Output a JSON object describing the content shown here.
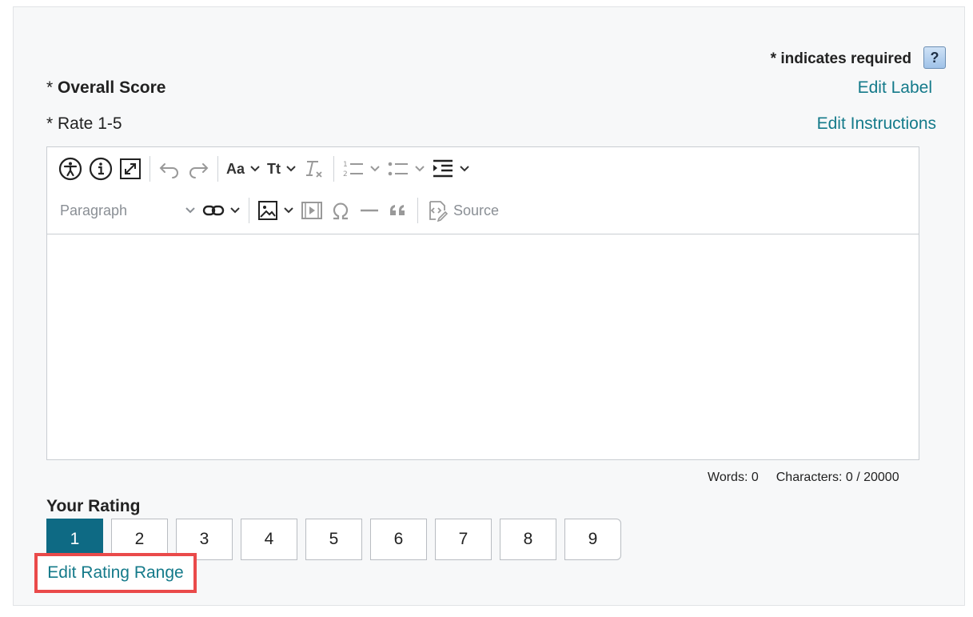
{
  "form": {
    "required_note": "* indicates required",
    "help_label": "?",
    "field_label_prefix": "* ",
    "field_label": "Overall Score",
    "edit_label_link": "Edit Label",
    "instructions": "* Rate 1-5",
    "edit_instructions_link": "Edit Instructions"
  },
  "editor": {
    "toolbar": {
      "font_size_label": "Aa",
      "text_transform_label": "Tt",
      "paragraph_select": "Paragraph",
      "source_label": "Source"
    },
    "content": "",
    "word_count": "Words: 0",
    "char_count": "Characters: 0 / 20000"
  },
  "rating": {
    "title": "Your Rating",
    "options": [
      "1",
      "2",
      "3",
      "4",
      "5",
      "6",
      "7",
      "8",
      "9"
    ],
    "selected": "1",
    "edit_range_link": "Edit Rating Range"
  },
  "colors": {
    "link": "#147a8a",
    "selected": "#0e6a84",
    "highlight": "#ea4a4a"
  }
}
